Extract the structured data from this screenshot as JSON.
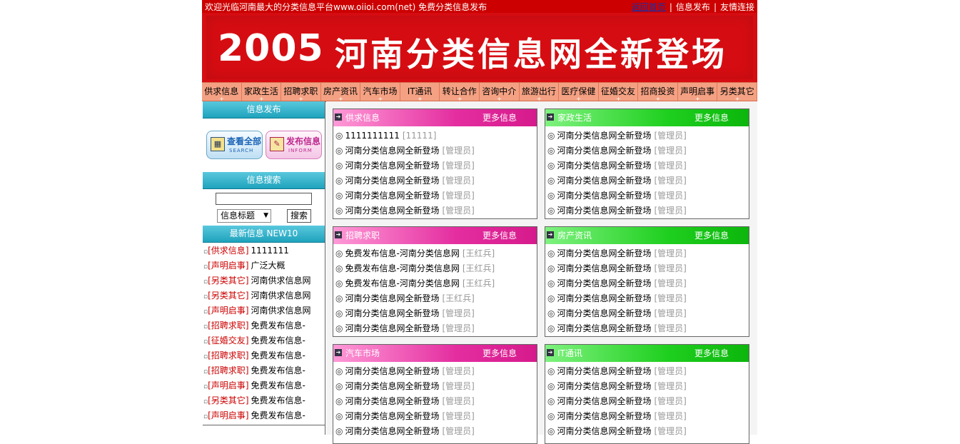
{
  "topbar": {
    "welcome": "欢迎光临河南最大的分类信息平台www.oiioi.com(net) 免费分类信息发布",
    "links": [
      "返回首页",
      "信息发布",
      "友情连接"
    ]
  },
  "banner": {
    "year": "2005",
    "text": "河南分类信息网全新登场"
  },
  "categories": [
    "供求信息",
    "家政生活",
    "招聘求职",
    "房产资讯",
    "汽车市场",
    "IT通讯",
    "转让合作",
    "咨询中介",
    "旅游出行",
    "医疗保健",
    "征婚交友",
    "招商投资",
    "声明启事",
    "另类其它"
  ],
  "sidebar": {
    "post_header": "信息发布",
    "btn_all": {
      "label": "查看全部",
      "sub": "SEARCH"
    },
    "btn_post": {
      "label": "发布信息",
      "sub": "INFORM"
    },
    "search_header": "信息搜索",
    "search_input_value": "",
    "search_select": "信息标题",
    "search_button": "搜索",
    "latest_header": "最新信息 NEW10",
    "latest": [
      {
        "cat": "供求信息",
        "title": "1111111"
      },
      {
        "cat": "声明启事",
        "title": "广泛大概"
      },
      {
        "cat": "另类其它",
        "title": "河南供求信息网"
      },
      {
        "cat": "另类其它",
        "title": "河南供求信息网"
      },
      {
        "cat": "声明启事",
        "title": "河南供求信息网"
      },
      {
        "cat": "招聘求职",
        "title": "免费发布信息-"
      },
      {
        "cat": "征婚交友",
        "title": "免费发布信息-"
      },
      {
        "cat": "招聘求职",
        "title": "免费发布信息-"
      },
      {
        "cat": "招聘求职",
        "title": "免费发布信息-"
      },
      {
        "cat": "声明启事",
        "title": "免费发布信息-"
      },
      {
        "cat": "另类其它",
        "title": "免费发布信息-"
      },
      {
        "cat": "声明启事",
        "title": "免费发布信息-"
      }
    ]
  },
  "panels": [
    {
      "title": "供求信息",
      "more": "更多信息",
      "items": [
        {
          "title": "1111111111",
          "author": "[11111]"
        },
        {
          "title": "河南分类信息网全新登场",
          "author": "[管理员]"
        },
        {
          "title": "河南分类信息网全新登场",
          "author": "[管理员]"
        },
        {
          "title": "河南分类信息网全新登场",
          "author": "[管理员]"
        },
        {
          "title": "河南分类信息网全新登场",
          "author": "[管理员]"
        },
        {
          "title": "河南分类信息网全新登场",
          "author": "[管理员]"
        }
      ]
    },
    {
      "title": "家政生活",
      "more": "更多信息",
      "items": [
        {
          "title": "河南分类信息网全新登场",
          "author": "[管理员]"
        },
        {
          "title": "河南分类信息网全新登场",
          "author": "[管理员]"
        },
        {
          "title": "河南分类信息网全新登场",
          "author": "[管理员]"
        },
        {
          "title": "河南分类信息网全新登场",
          "author": "[管理员]"
        },
        {
          "title": "河南分类信息网全新登场",
          "author": "[管理员]"
        },
        {
          "title": "河南分类信息网全新登场",
          "author": "[管理员]"
        }
      ]
    },
    {
      "title": "招聘求职",
      "more": "更多信息",
      "items": [
        {
          "title": "免费发布信息-河南分类信息网",
          "author": "[王红兵]"
        },
        {
          "title": "免费发布信息-河南分类信息网",
          "author": "[王红兵]"
        },
        {
          "title": "免费发布信息-河南分类信息网",
          "author": "[王红兵]"
        },
        {
          "title": "河南分类信息网全新登场",
          "author": "[王红兵]"
        },
        {
          "title": "河南分类信息网全新登场",
          "author": "[管理员]"
        },
        {
          "title": "河南分类信息网全新登场",
          "author": "[管理员]"
        }
      ]
    },
    {
      "title": "房产资讯",
      "more": "更多信息",
      "items": [
        {
          "title": "河南分类信息网全新登场",
          "author": "[管理员]"
        },
        {
          "title": "河南分类信息网全新登场",
          "author": "[管理员]"
        },
        {
          "title": "河南分类信息网全新登场",
          "author": "[管理员]"
        },
        {
          "title": "河南分类信息网全新登场",
          "author": "[管理员]"
        },
        {
          "title": "河南分类信息网全新登场",
          "author": "[管理员]"
        },
        {
          "title": "河南分类信息网全新登场",
          "author": "[管理员]"
        }
      ]
    },
    {
      "title": "汽车市场",
      "more": "更多信息",
      "items": [
        {
          "title": "河南分类信息网全新登场",
          "author": "[管理员]"
        },
        {
          "title": "河南分类信息网全新登场",
          "author": "[管理员]"
        },
        {
          "title": "河南分类信息网全新登场",
          "author": "[管理员]"
        },
        {
          "title": "河南分类信息网全新登场",
          "author": "[管理员]"
        },
        {
          "title": "河南分类信息网全新登场",
          "author": "[管理员]"
        }
      ]
    },
    {
      "title": "IT通讯",
      "more": "更多信息",
      "items": [
        {
          "title": "河南分类信息网全新登场",
          "author": "[管理员]"
        },
        {
          "title": "河南分类信息网全新登场",
          "author": "[管理员]"
        },
        {
          "title": "河南分类信息网全新登场",
          "author": "[管理员]"
        },
        {
          "title": "河南分类信息网全新登场",
          "author": "[管理员]"
        },
        {
          "title": "河南分类信息网全新登场",
          "author": "[管理员]"
        }
      ]
    }
  ],
  "icons": {
    "bullet": "◎",
    "list_bullet": "▫",
    "panel_arrow": "arrow-right-icon"
  },
  "colors": {
    "topbar": "#cc0000",
    "banner": "#d50d12",
    "nav": "#f4a183",
    "sidebar_header": "#1fa3bd",
    "panel_pink": "#e42ea0",
    "panel_green": "#1fcf1f",
    "link_red": "#cc0000"
  }
}
